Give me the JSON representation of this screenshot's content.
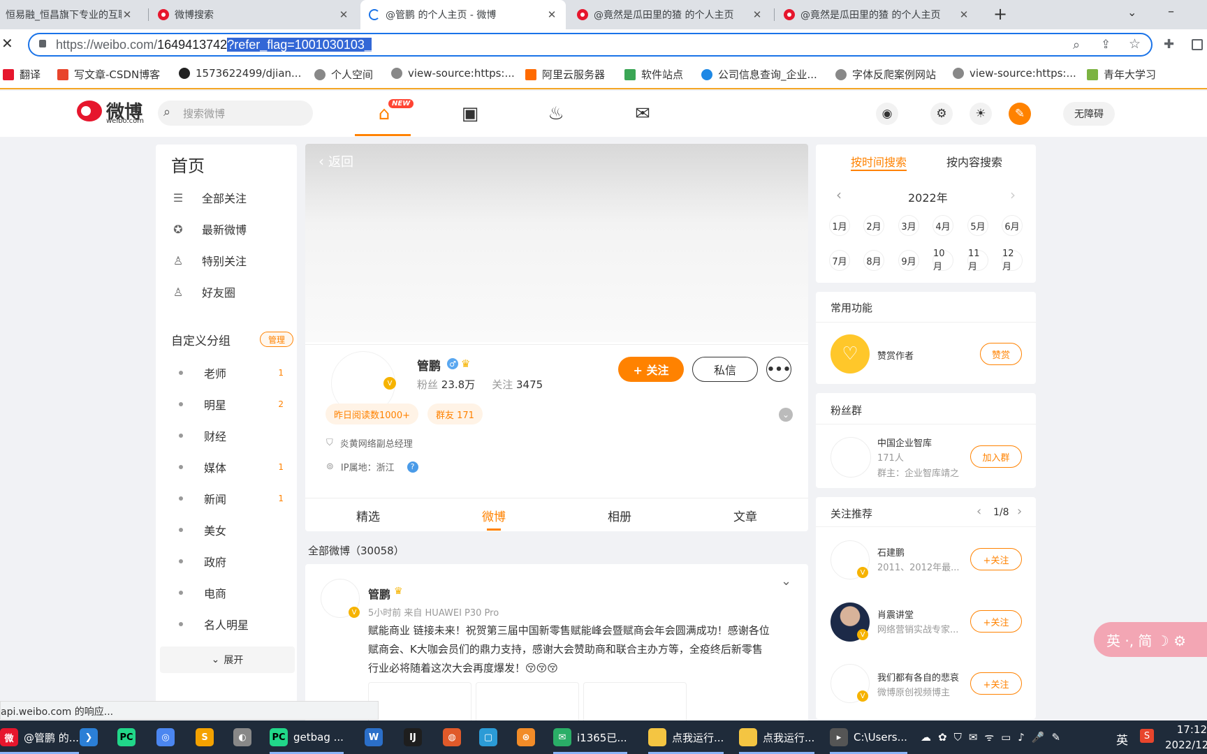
{
  "browser": {
    "tabs": [
      {
        "title": "恒易融_恒昌旗下专业的互联",
        "active": false
      },
      {
        "title": "微博搜索",
        "active": false
      },
      {
        "title": "@管鹏 的个人主页 - 微博",
        "active": true
      },
      {
        "title": "@竟然是瓜田里的猹 的个人主页",
        "active": false
      },
      {
        "title": "@竟然是瓜田里的猹 的个人主页",
        "active": false
      }
    ],
    "url_base": "https://weibo.com/",
    "url_path": "1649413742",
    "url_selected": "?refer_flag=1001030103_",
    "bookmarks": [
      "翻译",
      "写文章-CSDN博客",
      "1573622499/djian...",
      "个人空间",
      "view-source:https:...",
      "阿里云服务器",
      "软件站点",
      "公司信息查询_企业...",
      "字体反爬案例网站",
      "view-source:https:...",
      "青年大学习"
    ],
    "status": "api.weibo.com 的响应..."
  },
  "header": {
    "logo": "微博",
    "logo_sub": "weibo.com",
    "search_placeholder": "搜索微博",
    "new_badge": "NEW",
    "accessibility": "无障碍"
  },
  "sidebar": {
    "title": "首页",
    "items": [
      "全部关注",
      "最新微博",
      "特别关注",
      "好友圈"
    ],
    "group_title": "自定义分组",
    "manage": "管理",
    "groups": [
      {
        "name": "老师",
        "count": "1"
      },
      {
        "name": "明星",
        "count": "2"
      },
      {
        "name": "财经",
        "count": ""
      },
      {
        "name": "媒体",
        "count": "1"
      },
      {
        "name": "新闻",
        "count": "1"
      },
      {
        "name": "美女",
        "count": ""
      },
      {
        "name": "政府",
        "count": ""
      },
      {
        "name": "电商",
        "count": ""
      },
      {
        "name": "名人明星",
        "count": ""
      }
    ],
    "expand": "展开"
  },
  "profile": {
    "back": "返回",
    "name": "管鹏",
    "fans_label": "粉丝",
    "fans": "23.8万",
    "follow_label": "关注",
    "follow": "3475",
    "follow_btn": "+ 关注",
    "message_btn": "私信",
    "tag1": "昨日阅读数1000+",
    "tag2": "群友 171",
    "title": "炎黄网络副总经理",
    "ip": "IP属地：浙江",
    "tabs": [
      "精选",
      "微博",
      "相册",
      "文章"
    ],
    "active_tab": "微博",
    "all_weibo": "全部微博（30058）"
  },
  "post": {
    "author": "管鹏",
    "meta": "5小时前 来自 HUAWEI P30 Pro",
    "text_lines": [
      "赋能商业 链接未来！祝贺第三届中国新零售赋能峰会暨赋商会年会圆满成功！感谢各位",
      "赋商会、K大咖会员们的鼎力支持，感谢大会赞助商和联合主办方等，全疫终后新零售",
      "行业必将随着这次大会再度爆发！😚😚😚"
    ]
  },
  "right": {
    "search_tabs": [
      "按时间搜索",
      "按内容搜索"
    ],
    "year": "2022年",
    "months": [
      "1月",
      "2月",
      "3月",
      "4月",
      "5月",
      "6月",
      "7月",
      "8月",
      "9月",
      "10月",
      "11月",
      "12月"
    ],
    "common_title": "常用功能",
    "reward_label": "赞赏作者",
    "reward_btn": "赞赏",
    "fans_group_title": "粉丝群",
    "group_name": "中国企业智库",
    "group_count": "171人",
    "group_owner": "群主：企业智库靖之",
    "join_btn": "加入群",
    "recommend_title": "关注推荐",
    "recommend_page": "1/8",
    "recommend": [
      {
        "name": "石建鹏",
        "desc": "2011、2012年最...",
        "btn": "+关注"
      },
      {
        "name": "肖震讲堂",
        "desc": "网络营销实战专家...",
        "btn": "+关注"
      },
      {
        "name": "我们都有各自的悲哀",
        "desc": "微博原创视频博主",
        "btn": "+关注"
      }
    ]
  },
  "ime": "英 ·, 简 ☽ ⚙",
  "taskbar": {
    "items": [
      {
        "label": "@管鹏 的...",
        "color": "#e6162d"
      },
      {
        "label": "",
        "color": "#2b7fd6"
      },
      {
        "label": "",
        "color": "#21d789"
      },
      {
        "label": "",
        "color": "#4b86f0"
      },
      {
        "label": "",
        "color": "#f4a200"
      },
      {
        "label": "",
        "color": "#888"
      },
      {
        "label": "getbag ...",
        "color": "#21d789"
      },
      {
        "label": "",
        "color": "#2b6fc9"
      },
      {
        "label": "",
        "color": "#1e1e1e"
      },
      {
        "label": "",
        "color": "#e05a2a"
      },
      {
        "label": "",
        "color": "#2b9bd6"
      },
      {
        "label": "",
        "color": "#f28c28"
      },
      {
        "label": "i1365已...",
        "color": "#2aae67"
      },
      {
        "label": "点我运行...",
        "color": "#f4c542"
      },
      {
        "label": "点我运行...",
        "color": "#f4c542"
      },
      {
        "label": "C:\\Users...",
        "color": "#555"
      }
    ],
    "clock_time": "17:12",
    "clock_date": "2022/12",
    "lang": "英"
  }
}
